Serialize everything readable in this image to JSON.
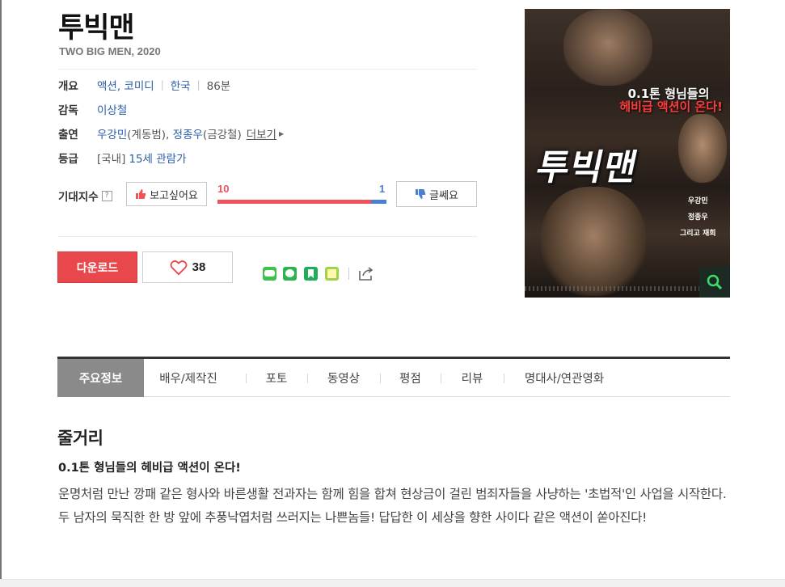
{
  "movie": {
    "title": "투빅맨",
    "subtitle": "TWO BIG MEN, 2020"
  },
  "info": {
    "overview": {
      "label": "개요",
      "genre": "액션, 코미디",
      "country": "한국",
      "runtime": "86분"
    },
    "director": {
      "label": "감독",
      "name": "이상철"
    },
    "cast": {
      "label": "출연",
      "actor1": "우강민",
      "role1": "(계동범), ",
      "actor2": "정종우",
      "role2": "(금강철)",
      "more": "더보기"
    },
    "rating": {
      "label": "등급",
      "region": "[국내]",
      "grade": "15세 관람가"
    }
  },
  "expectation": {
    "label": "기대지수",
    "help": "?",
    "want_label": "보고싶어요",
    "want_count": "10",
    "no_count": "1",
    "no_label": "글쎄요",
    "want_fraction": 0.91,
    "colors": {
      "want": "#f0525a",
      "no": "#4a7fd6"
    }
  },
  "actions": {
    "download_label": "다운로드",
    "like_count": "38",
    "share_icons": [
      "line-icon",
      "kakao-icon",
      "bookmark-icon",
      "note-icon",
      "share-icon"
    ]
  },
  "poster": {
    "tagline_line1": "0.1톤 형님들의",
    "tagline_line2": "헤비급 액션이 온다!",
    "title_art": "투빅맨",
    "credits": [
      "우강민",
      "정종우",
      "그리고 재희"
    ]
  },
  "tabs": [
    "주요정보",
    "배우/제작진",
    "포토",
    "동영상",
    "평점",
    "리뷰",
    "명대사/연관영화"
  ],
  "synopsis": {
    "section_title": "줄거리",
    "headline": "0.1톤 형님들의 헤비급 액션이 온다!",
    "body": "운명처럼 만난 깡패 같은 형사와 바른생활 전과자는 함께 힘을 합쳐 현상금이 걸린 범죄자들을 사냥하는 '초법적'인 사업을 시작한다. 두 남자의 묵직한 한 방 앞에 추풍낙엽처럼 쓰러지는 나쁜놈들! 답답한 이 세상을 향한 사이다 같은 액션이 쏟아진다!"
  },
  "colors": {
    "accent": "#e8474b",
    "link": "#2b5ea8"
  }
}
